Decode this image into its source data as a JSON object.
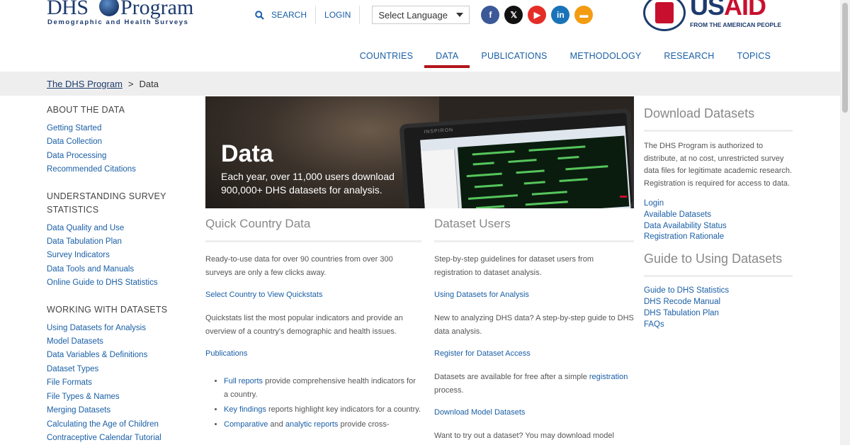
{
  "logo": {
    "part1": "DHS",
    "part2": "Program",
    "tagline": "Demographic and Health Surveys"
  },
  "utility": {
    "search_label": "SEARCH",
    "login_label": "LOGIN",
    "language_select": "Select Language"
  },
  "social": [
    {
      "name": "facebook",
      "glyph": "f",
      "color": "#3b5998"
    },
    {
      "name": "x",
      "glyph": "𝕏",
      "color": "#111111"
    },
    {
      "name": "youtube",
      "glyph": "▶",
      "color": "#e52d27"
    },
    {
      "name": "linkedin",
      "glyph": "in",
      "color": "#1a73b8"
    },
    {
      "name": "blog",
      "glyph": "▬",
      "color": "#f39c12"
    }
  ],
  "usaid": {
    "us": "US",
    "aid": "AID",
    "tagline": "FROM THE AMERICAN PEOPLE"
  },
  "nav": {
    "countries": "COUNTRIES",
    "data": "DATA",
    "publications": "PUBLICATIONS",
    "methodology": "METHODOLOGY",
    "research": "RESEARCH",
    "topics": "TOPICS"
  },
  "breadcrumb": {
    "home": "The DHS Program",
    "separator": ">",
    "current": "Data"
  },
  "sidebar": {
    "groups": [
      {
        "title": "ABOUT THE DATA",
        "items": [
          "Getting Started",
          "Data Collection",
          "Data Processing",
          "Recommended Citations"
        ]
      },
      {
        "title": "UNDERSTANDING SURVEY STATISTICS",
        "items": [
          "Data Quality and Use",
          "Data Tabulation Plan",
          "Survey Indicators",
          "Data Tools and Manuals",
          "Online Guide to DHS Statistics"
        ]
      },
      {
        "title": "WORKING WITH DATASETS",
        "items": [
          "Using Datasets for Analysis",
          "Model Datasets",
          "Data Variables & Definitions",
          "Dataset Types",
          "File Formats",
          "File Types & Names",
          "Merging Datasets",
          "Calculating the Age of Children",
          "Contraceptive Calendar Tutorial"
        ]
      }
    ]
  },
  "hero": {
    "title": "Data",
    "subtitle": "Each year, over 11,000 users download 900,000+ DHS datasets for analysis.",
    "screen_brand": "INSPIRON"
  },
  "quick": {
    "heading": "Quick Country Data",
    "intro": "Ready-to-use data for over 90 countries from over 300 surveys are only a few clicks away.",
    "link1": "Select Country to View Quickstats",
    "text2": "Quickstats list the most popular indicators and provide an overview of a country's demographic and health issues.",
    "link2": "Publications",
    "bullets": {
      "b1_link": "Full reports",
      "b1_text": " provide comprehensive health indicators for a country.",
      "b2_link": "Key findings",
      "b2_text": " reports highlight key indicators for a country.",
      "b3_link": "Comparative",
      "b3_mid": " and ",
      "b3_link2": "analytic reports",
      "b3_text": " provide cross-"
    }
  },
  "users": {
    "heading": "Dataset Users",
    "intro": "Step-by-step guidelines for dataset users from registration to dataset analysis.",
    "link1": "Using Datasets for Analysis",
    "text2": "New to analyzing DHS data? A step-by-step guide to DHS data analysis.",
    "link2": "Register for Dataset Access",
    "text3a": "Datasets are available for free after a simple ",
    "text3_link": "registration",
    "text3b": " process.",
    "link3": "Download Model Datasets",
    "text4": "Want to try out a dataset? You may download model"
  },
  "right": {
    "download_heading": "Download Datasets",
    "download_text": "The DHS Program is authorized to distribute, at no cost, unrestricted survey data files for legitimate academic research. Registration is required for access to data.",
    "download_links": [
      "Login",
      "Available Datasets",
      "Data Availability Status",
      "Registration Rationale"
    ],
    "guide_heading": "Guide to Using Datasets",
    "guide_links": [
      "Guide to DHS Statistics",
      "DHS Recode Manual",
      "DHS Tabulation Plan",
      "FAQs"
    ]
  }
}
